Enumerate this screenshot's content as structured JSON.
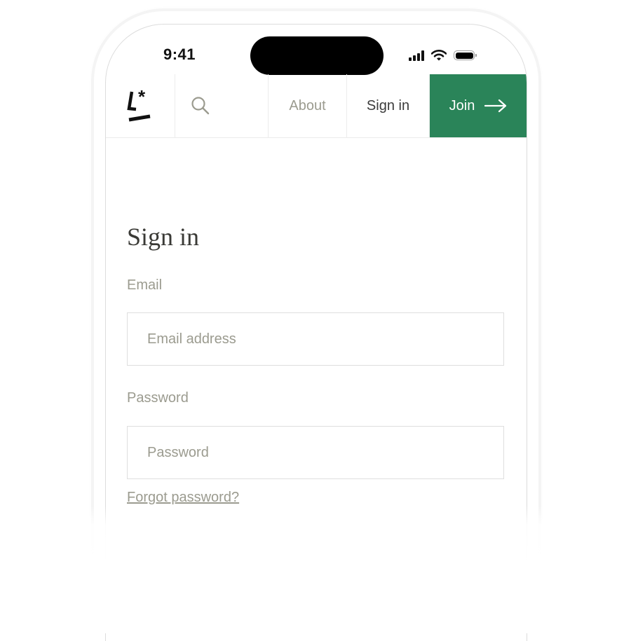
{
  "status_bar": {
    "time": "9:41",
    "icons": [
      "signal-icon",
      "wifi-icon",
      "battery-icon"
    ]
  },
  "nav": {
    "logo": "L*",
    "search_icon": "search-icon",
    "about": "About",
    "sign_in": "Sign in",
    "join": "Join",
    "join_icon": "arrow-right-icon",
    "accent_color": "#2a8459"
  },
  "form": {
    "title": "Sign in",
    "email_label": "Email",
    "email_placeholder": "Email address",
    "email_value": "",
    "password_label": "Password",
    "password_placeholder": "Password",
    "password_value": "",
    "forgot_link": "Forgot password?"
  }
}
